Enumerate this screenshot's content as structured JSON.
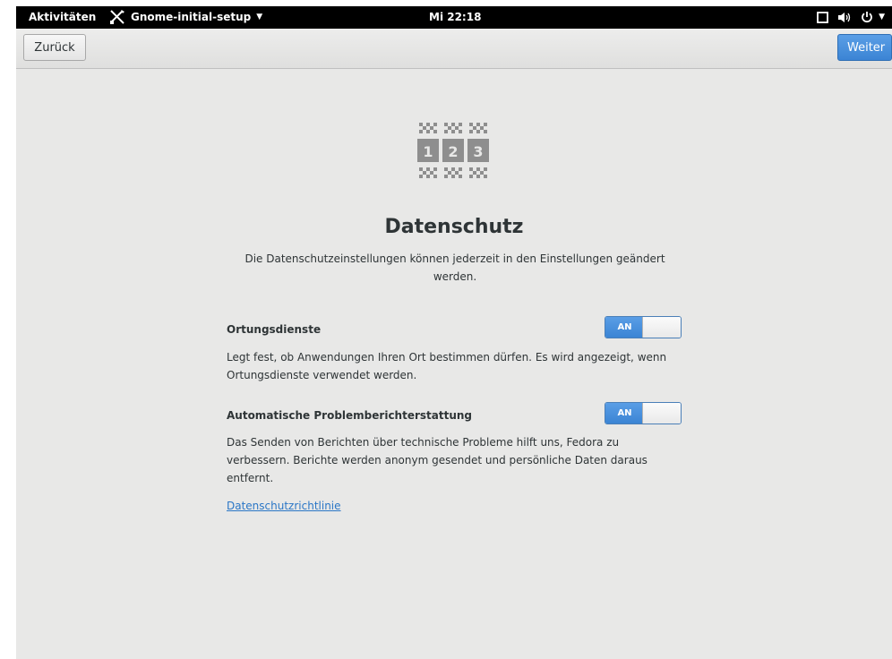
{
  "topbar": {
    "activities": "Aktivitäten",
    "app_name": "Gnome-initial-setup",
    "clock": "Mi 22:18",
    "icons": [
      "screen-icon",
      "volume-icon",
      "power-icon"
    ]
  },
  "header": {
    "back_label": "Zurück",
    "next_label": "Weiter"
  },
  "page": {
    "icon": "privacy-icon",
    "title": "Datenschutz",
    "subtitle": "Die Datenschutzeinstellungen können jederzeit in den Einstellungen geändert werden."
  },
  "settings": [
    {
      "label": "Ortungsdienste",
      "description": "Legt fest, ob Anwendungen Ihren Ort bestimmen dürfen. Es wird angezeigt, wenn Ortungsdienste verwendet werden.",
      "state": "AN"
    },
    {
      "label": "Automatische Problemberichterstattung",
      "description": "Das Senden von Berichten über technische Probleme hilft uns, Fedora zu verbessern. Berichte werden anonym gesendet und persönliche Daten daraus entfernt.",
      "state": "AN"
    }
  ],
  "privacy_link": "Datenschutzrichtlinie",
  "colors": {
    "accent": "#4a90d9",
    "background": "#e8e8e7",
    "topbar": "#000000",
    "link": "#2a76c6"
  }
}
